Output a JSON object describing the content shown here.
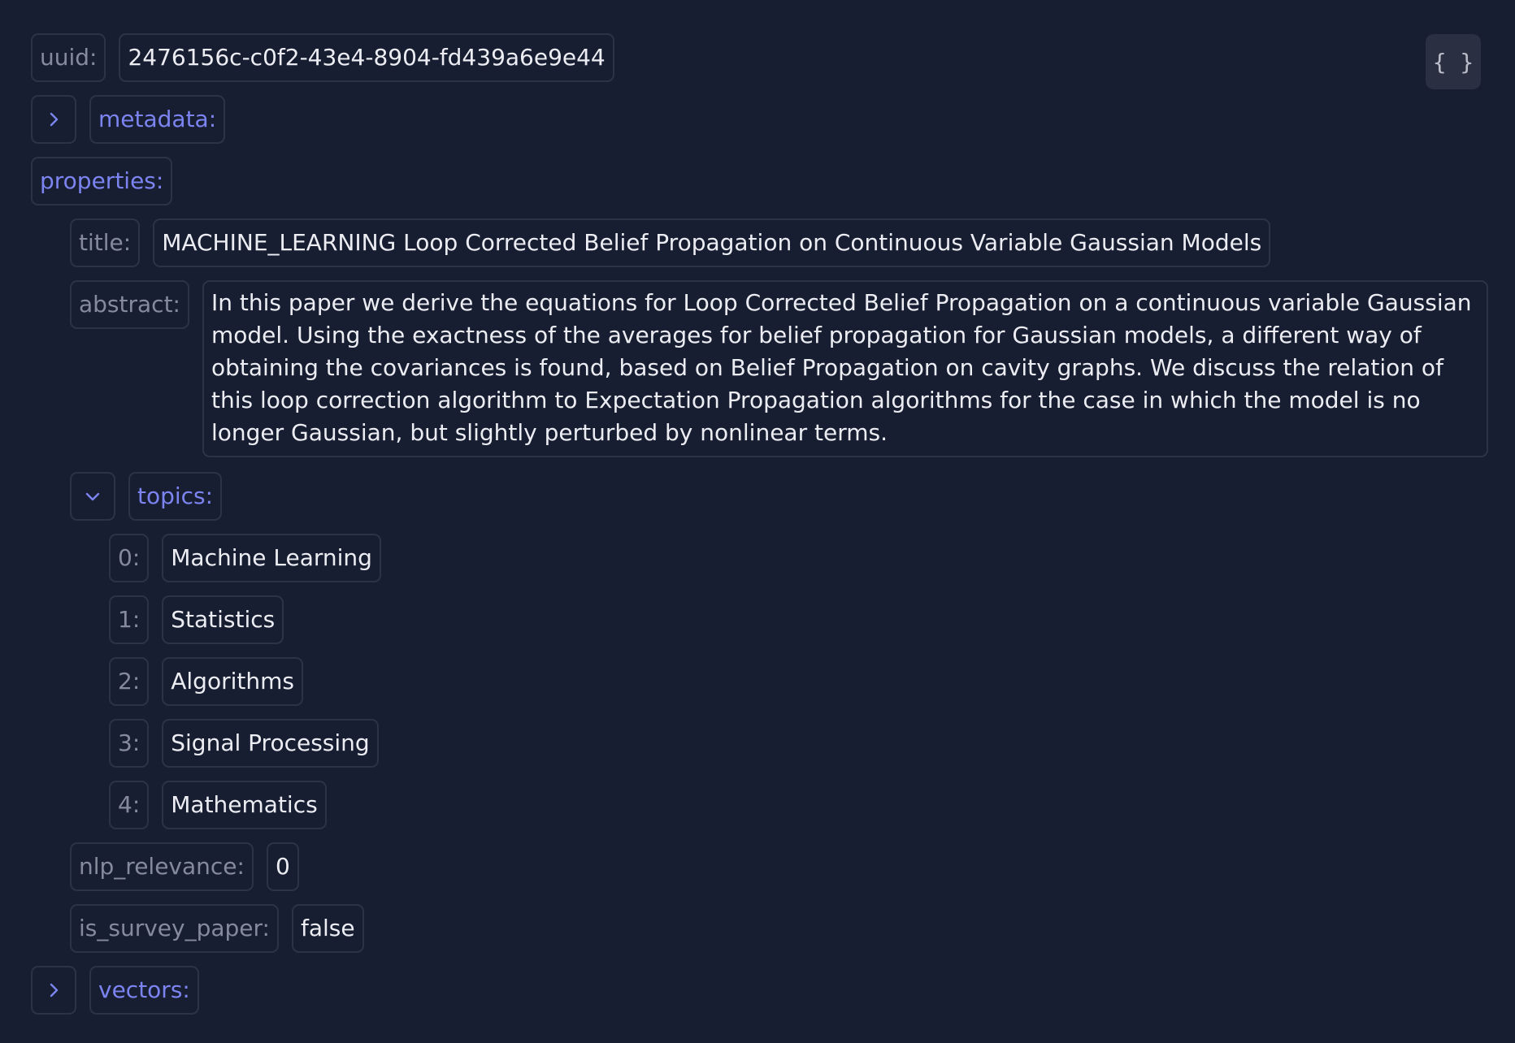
{
  "uuid": {
    "key": "uuid:",
    "value": "2476156c-c0f2-43e4-8904-fd439a6e9e44"
  },
  "json_button": {
    "label": "{ }"
  },
  "metadata": {
    "key": "metadata:"
  },
  "properties": {
    "key": "properties:",
    "title": {
      "key": "title:",
      "value": "MACHINE_LEARNING Loop Corrected Belief Propagation on Continuous Variable Gaussian Models"
    },
    "abstract": {
      "key": "abstract:",
      "value": "In this paper we derive the equations for Loop Corrected Belief Propagation on a continuous variable Gaussian model. Using the exactness of the averages for belief propagation for Gaussian models, a different way of obtaining the covariances is found, based on Belief Propagation on cavity graphs. We discuss the relation of this loop correction algorithm to Expectation Propagation algorithms for the case in which the model is no longer Gaussian, but slightly perturbed by nonlinear terms."
    },
    "topics": {
      "key": "topics:",
      "items": [
        {
          "index": "0:",
          "value": "Machine Learning"
        },
        {
          "index": "1:",
          "value": "Statistics"
        },
        {
          "index": "2:",
          "value": "Algorithms"
        },
        {
          "index": "3:",
          "value": "Signal Processing"
        },
        {
          "index": "4:",
          "value": "Mathematics"
        }
      ]
    },
    "nlp_relevance": {
      "key": "nlp_relevance:",
      "value": "0"
    },
    "is_survey_paper": {
      "key": "is_survey_paper:",
      "value": "false"
    }
  },
  "vectors": {
    "key": "vectors:"
  },
  "icons": {
    "collapsed": "chevron-right-icon",
    "expanded": "chevron-down-icon"
  },
  "colors": {
    "background": "#181e32",
    "object_key": "#7b84f0",
    "key": "#858b9c",
    "border": "#2c3348"
  }
}
